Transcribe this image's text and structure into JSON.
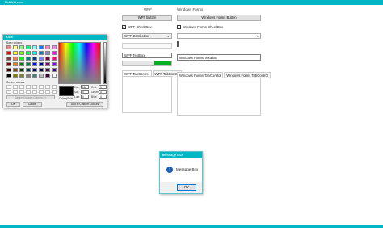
{
  "window": {
    "title": "MainWindow"
  },
  "wpf": {
    "header": "WPF",
    "button": "WPF Button",
    "checkbox": "WPF CheckBox",
    "combobox": "WPF ComboBox",
    "textbox": "WPF TextBox",
    "progress_value": 0.35,
    "tabs": [
      "WPF TabControl",
      "WPF TabControl"
    ]
  },
  "winforms": {
    "header": "Windows Forms",
    "button": "Windows Forms Button",
    "checkbox": "Windows Forms CheckBox",
    "textbox": "Windows Forms TextBox",
    "tabs": [
      "Windows Forms TabControl",
      "Windows Forms TabControl"
    ]
  },
  "color_dialog": {
    "title": "Color",
    "basic_label": "Basic colours:",
    "custom_label": "Custom colours:",
    "define_button": "Define Custom Colours >>",
    "ok": "OK",
    "cancel": "Cancel",
    "add_button": "Add to Custom Colours",
    "color_solid_label": "Colour|Solid",
    "hue_label": "Hue:",
    "hue": "160",
    "sat_label": "Sat:",
    "sat": "0",
    "lum_label": "Lum:",
    "lum": "0",
    "red_label": "Red:",
    "red": "0",
    "green_label": "Green:",
    "green": "0",
    "blue_label": "Blue:",
    "blue": "0",
    "basic_colors": [
      "#ff8080",
      "#ffff80",
      "#80ff80",
      "#00ff80",
      "#80ffff",
      "#0080ff",
      "#ff80c0",
      "#ff80ff",
      "#ff0000",
      "#ffff00",
      "#80ff00",
      "#00ff40",
      "#00ffff",
      "#0080c0",
      "#8080c0",
      "#ff00ff",
      "#804040",
      "#ff8040",
      "#00ff00",
      "#008080",
      "#004080",
      "#8080ff",
      "#800040",
      "#ff0080",
      "#800000",
      "#ff8000",
      "#008000",
      "#008040",
      "#0000ff",
      "#0000a0",
      "#800080",
      "#8000ff",
      "#400000",
      "#804000",
      "#004000",
      "#004040",
      "#000080",
      "#000040",
      "#400040",
      "#400080",
      "#000000",
      "#808000",
      "#808040",
      "#808080",
      "#408080",
      "#c0c0c0",
      "#400040",
      "#ffffff"
    ]
  },
  "message_box": {
    "title": "Message Box",
    "text": "Message Box",
    "ok": "OK"
  }
}
